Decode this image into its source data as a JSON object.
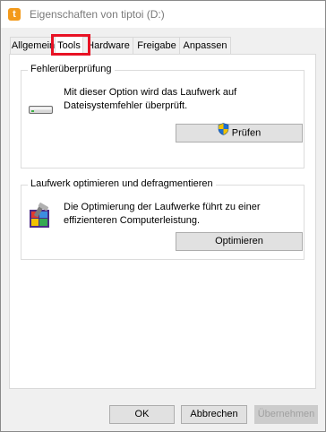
{
  "window": {
    "title": "Eigenschaften von tiptoi (D:)",
    "icon_letter": "t"
  },
  "tabs": [
    {
      "label": "Allgemein"
    },
    {
      "label": "Tools"
    },
    {
      "label": "Hardware"
    },
    {
      "label": "Freigabe"
    },
    {
      "label": "Anpassen"
    }
  ],
  "active_tab": "Tools",
  "error_check": {
    "title": "Fehlerüberprüfung",
    "description_line1": "Mit dieser Option wird das Laufwerk auf",
    "description_line2": "Dateisystemfehler überprüft.",
    "button_label": "Prüfen",
    "icon": "drive-icon"
  },
  "optimize": {
    "title": "Laufwerk optimieren und defragmentieren",
    "description_line1": "Die Optimierung der Laufwerke führt zu einer",
    "description_line2": "effizienteren Computerleistung.",
    "button_label": "Optimieren",
    "icon": "defrag-icon"
  },
  "footer": {
    "ok_label": "OK",
    "cancel_label": "Abbrechen",
    "apply_label": "Übernehmen",
    "apply_disabled": true
  },
  "colors": {
    "highlight": "#e81224",
    "app_icon": "#f39a1b",
    "button_face": "#e1e1e1"
  }
}
